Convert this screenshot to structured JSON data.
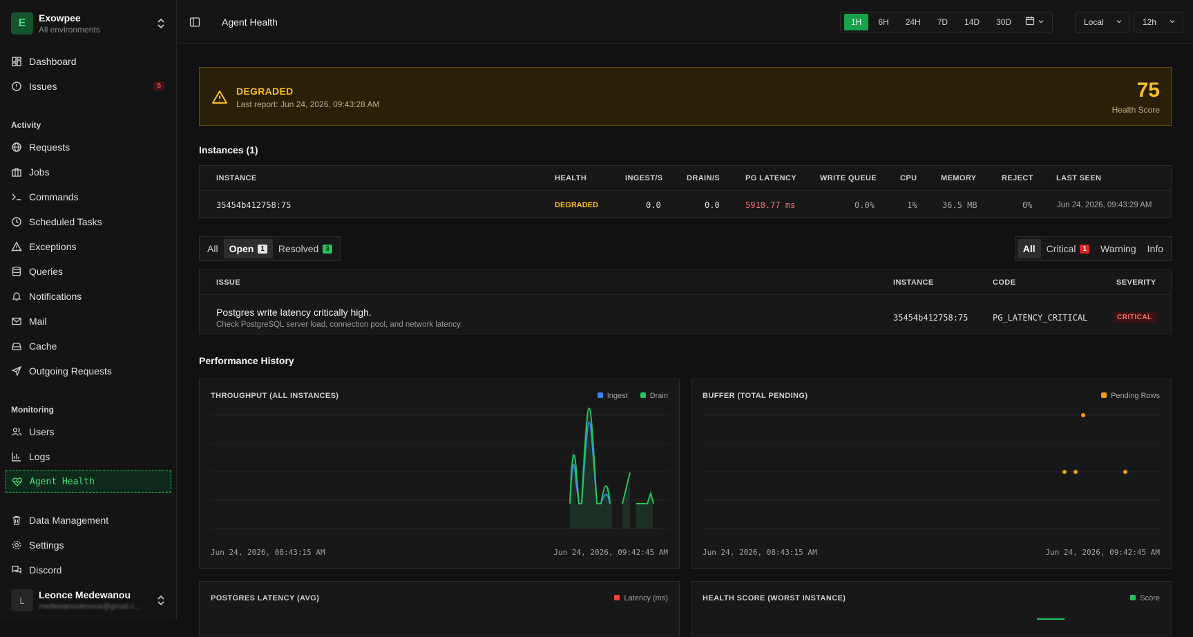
{
  "workspace": {
    "initial": "E",
    "name": "Exowpee",
    "subtitle": "All environments"
  },
  "nav": {
    "dashboard": "Dashboard",
    "issues": "Issues",
    "issues_badge": "5",
    "activity_label": "Activity",
    "requests": "Requests",
    "jobs": "Jobs",
    "commands": "Commands",
    "scheduled_tasks": "Scheduled Tasks",
    "exceptions": "Exceptions",
    "queries": "Queries",
    "notifications": "Notifications",
    "mail": "Mail",
    "cache": "Cache",
    "outgoing_requests": "Outgoing Requests",
    "monitoring_label": "Monitoring",
    "users": "Users",
    "logs": "Logs",
    "agent_health": "Agent Health",
    "data_management": "Data Management",
    "settings": "Settings",
    "discord": "Discord"
  },
  "user": {
    "initial": "L",
    "name": "Leonce Medewanou",
    "email": "medewanouleonce@gmail.c..."
  },
  "header": {
    "title": "Agent Health",
    "ranges": [
      "1H",
      "6H",
      "24H",
      "7D",
      "14D",
      "30D"
    ],
    "active_range": "1H",
    "timezone": "Local",
    "clock": "12h"
  },
  "alert": {
    "status": "DEGRADED",
    "last_report": "Last report: Jun 24, 2026, 09:43:28 AM",
    "score": "75",
    "score_label": "Health Score"
  },
  "instances": {
    "title": "Instances (1)",
    "columns": {
      "instance": "INSTANCE",
      "health": "HEALTH",
      "ingest": "INGEST/S",
      "drain": "DRAIN/S",
      "pg_latency": "PG LATENCY",
      "write_queue": "WRITE QUEUE",
      "cpu": "CPU",
      "memory": "MEMORY",
      "reject": "REJECT",
      "last_seen": "LAST SEEN"
    },
    "row": {
      "instance": "35454b412758:75",
      "health": "DEGRADED",
      "ingest": "0.0",
      "drain": "0.0",
      "pg_latency": "5918.77 ms",
      "write_queue": "0.0%",
      "cpu": "1%",
      "memory": "36.5 MB",
      "reject": "0%",
      "last_seen": "Jun 24, 2026, 09:43:29 AM"
    }
  },
  "issue_filters": {
    "status": {
      "all": "All",
      "open": "Open",
      "open_count": "1",
      "resolved": "Resolved",
      "resolved_count": "3"
    },
    "severity": {
      "all": "All",
      "critical": "Critical",
      "critical_count": "1",
      "warning": "Warning",
      "info": "Info"
    }
  },
  "issues_table": {
    "columns": {
      "issue": "ISSUE",
      "instance": "INSTANCE",
      "code": "CODE",
      "severity": "SEVERITY"
    },
    "row": {
      "title": "Postgres write latency critically high.",
      "hint": "Check PostgreSQL server load, connection pool, and network latency.",
      "instance": "35454b412758:75",
      "code": "PG_LATENCY_CRITICAL",
      "severity": "CRITICAL"
    }
  },
  "performance": {
    "title": "Performance History",
    "throughput": {
      "title": "THROUGHPUT (ALL INSTANCES)",
      "legend_ingest": "Ingest",
      "legend_drain": "Drain",
      "x_start": "Jun 24, 2026, 08:43:15 AM",
      "x_end": "Jun 24, 2026, 09:42:45 AM"
    },
    "buffer": {
      "title": "BUFFER (TOTAL PENDING)",
      "legend": "Pending Rows",
      "x_start": "Jun 24, 2026, 08:43:15 AM",
      "x_end": "Jun 24, 2026, 09:42:45 AM"
    },
    "latency": {
      "title": "POSTGRES LATENCY (AVG)",
      "legend": "Latency (ms)"
    },
    "health": {
      "title": "HEALTH SCORE (WORST INSTANCE)",
      "legend": "Score"
    }
  },
  "colors": {
    "accent": "#16a34a",
    "warning": "#fbbf24",
    "critical": "#f87171",
    "ingest": "#3b82f6",
    "drain": "#22c55e",
    "pending": "#f59e0b",
    "latency": "#ef4444"
  }
}
